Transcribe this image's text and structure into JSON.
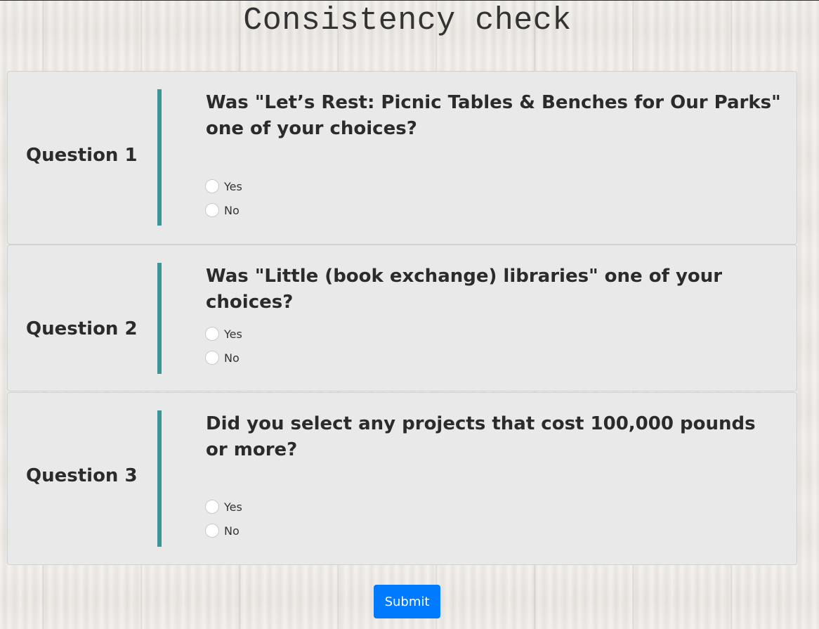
{
  "page": {
    "title": "Consistency check"
  },
  "questions": [
    {
      "label": "Question 1",
      "text": "Was \"Let’s Rest: Picnic Tables & Benches for Our Parks\" one of your choices?",
      "options": [
        "Yes",
        "No"
      ]
    },
    {
      "label": "Question 2",
      "text": "Was \"Little (book exchange) libraries\" one of your choices?",
      "options": [
        "Yes",
        "No"
      ]
    },
    {
      "label": "Question 3",
      "text": "Did you select any projects that cost 100,000 pounds or more?",
      "options": [
        "Yes",
        "No"
      ]
    }
  ],
  "submit": {
    "label": "Submit"
  },
  "colors": {
    "accent": "#3d9696",
    "button": "#007bff",
    "card": "#e9e9e9"
  }
}
